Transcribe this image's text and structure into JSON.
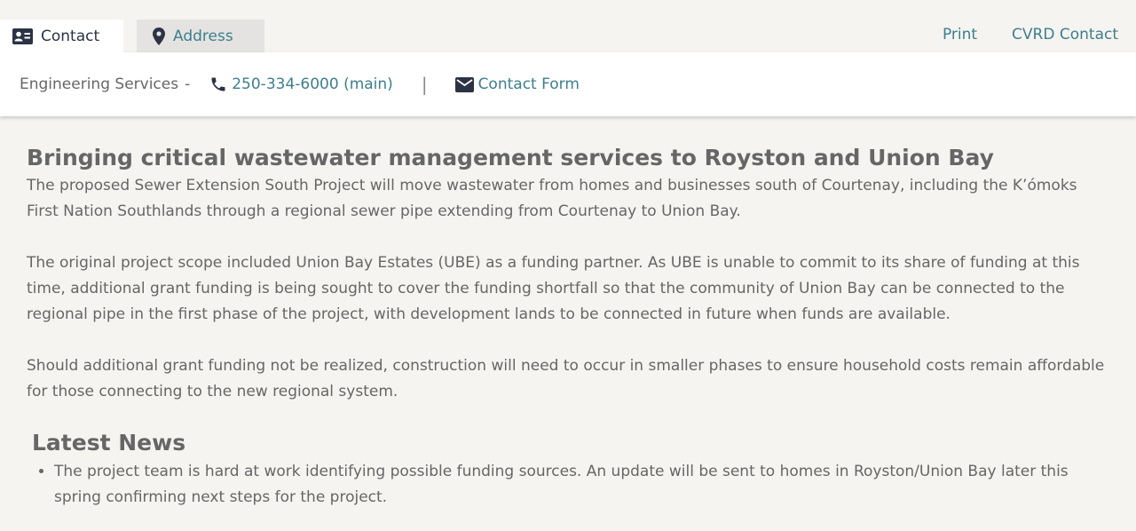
{
  "tabs": {
    "contact_label": "Contact",
    "address_label": "Address"
  },
  "top_links": {
    "print": "Print",
    "cvrd_contact": "CVRD Contact"
  },
  "contact_panel": {
    "department": "Engineering Services",
    "dash": "-",
    "phone": "250-334-6000 (main)",
    "pipe": "|",
    "form_link": "Contact Form"
  },
  "main": {
    "title": "Bringing critical wastewater management services to Royston and Union Bay",
    "paragraphs": [
      "The proposed Sewer Extension South Project will move wastewater from homes and businesses south of Courtenay, including the K’ómoks First Nation Southlands through a regional sewer pipe extending from Courtenay to Union Bay.",
      "The original project scope included Union Bay Estates (UBE) as a funding partner. As UBE is unable to commit to its share of funding at this time, additional grant funding is being sought to cover the funding shortfall so that the community of Union Bay can be connected to the regional pipe in the first phase of the project, with development lands to be connected in future when funds are available.",
      "Should additional grant funding not be realized, construction will need to occur in smaller phases to ensure household costs remain affordable for those connecting to the new regional system."
    ]
  },
  "news": {
    "title": "Latest News",
    "items": [
      "The project team is hard at work identifying possible funding sources. An update will be sent to homes in Royston/Union Bay later this spring confirming next steps for the project."
    ]
  },
  "colors": {
    "link": "#3d7f8c",
    "text": "#666666",
    "icon_dark": "#2b3344",
    "background": "#f5f4f1"
  },
  "icons": {
    "contact_tab": "contact-card-icon",
    "address_tab": "map-pin-icon",
    "phone": "phone-icon",
    "email": "envelope-icon"
  }
}
